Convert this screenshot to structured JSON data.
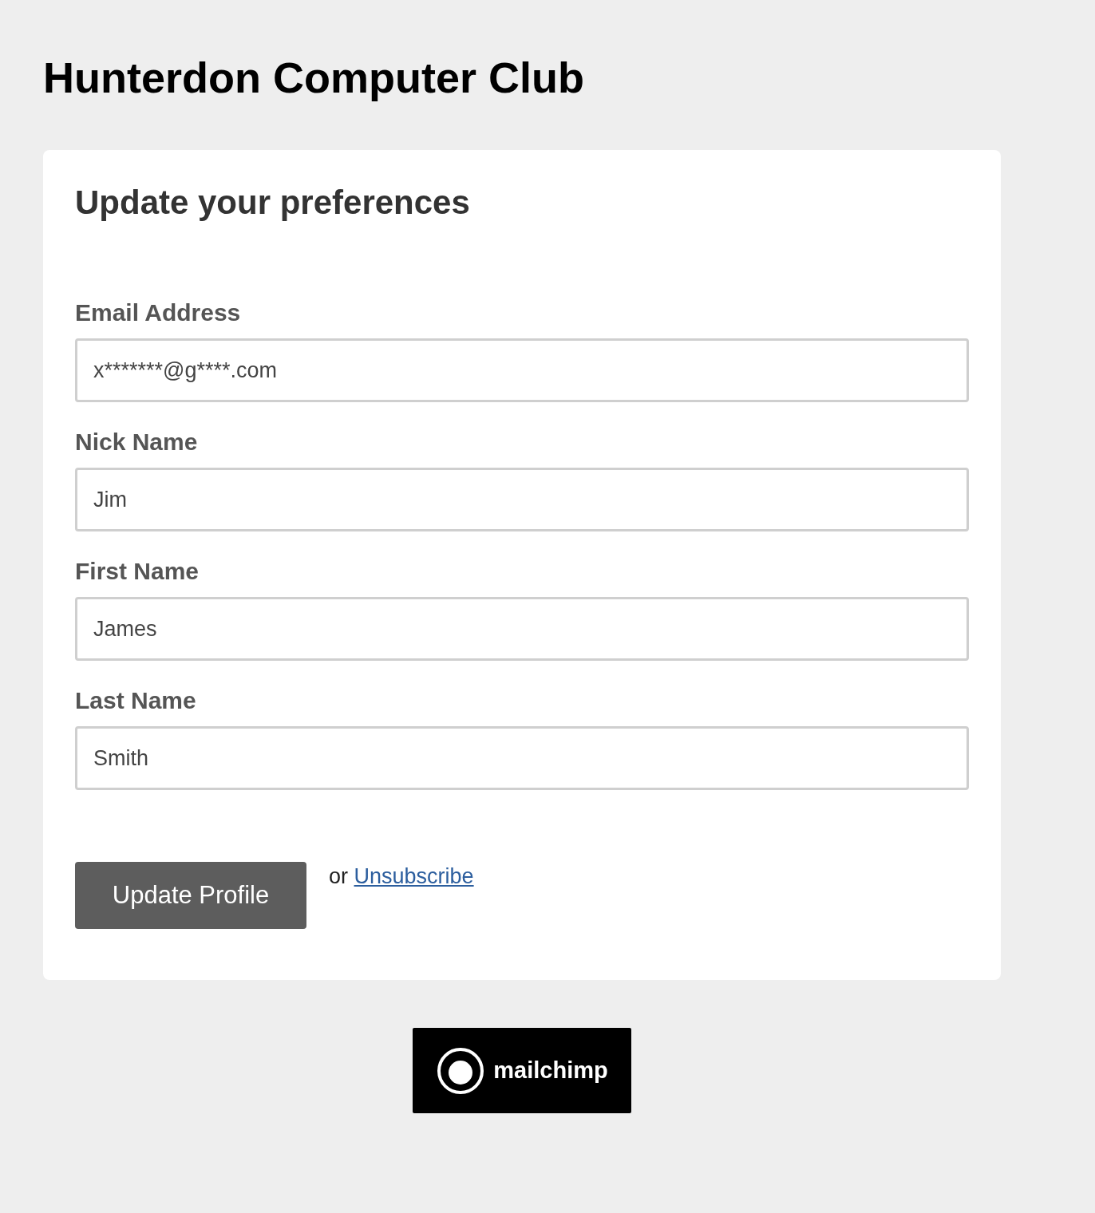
{
  "title": "Hunterdon Computer Club",
  "card": {
    "heading": "Update your preferences",
    "fields": [
      {
        "label": "Email Address",
        "value": "x*******@g****.com"
      },
      {
        "label": "Nick Name",
        "value": "Jim"
      },
      {
        "label": "First Name",
        "value": "James"
      },
      {
        "label": "Last Name",
        "value": "Smith"
      }
    ],
    "submit": "Update Profile",
    "or_text": "or",
    "unsubscribe_link": "Unsubscribe"
  },
  "footer_badge": {
    "text": "mailchimp"
  }
}
